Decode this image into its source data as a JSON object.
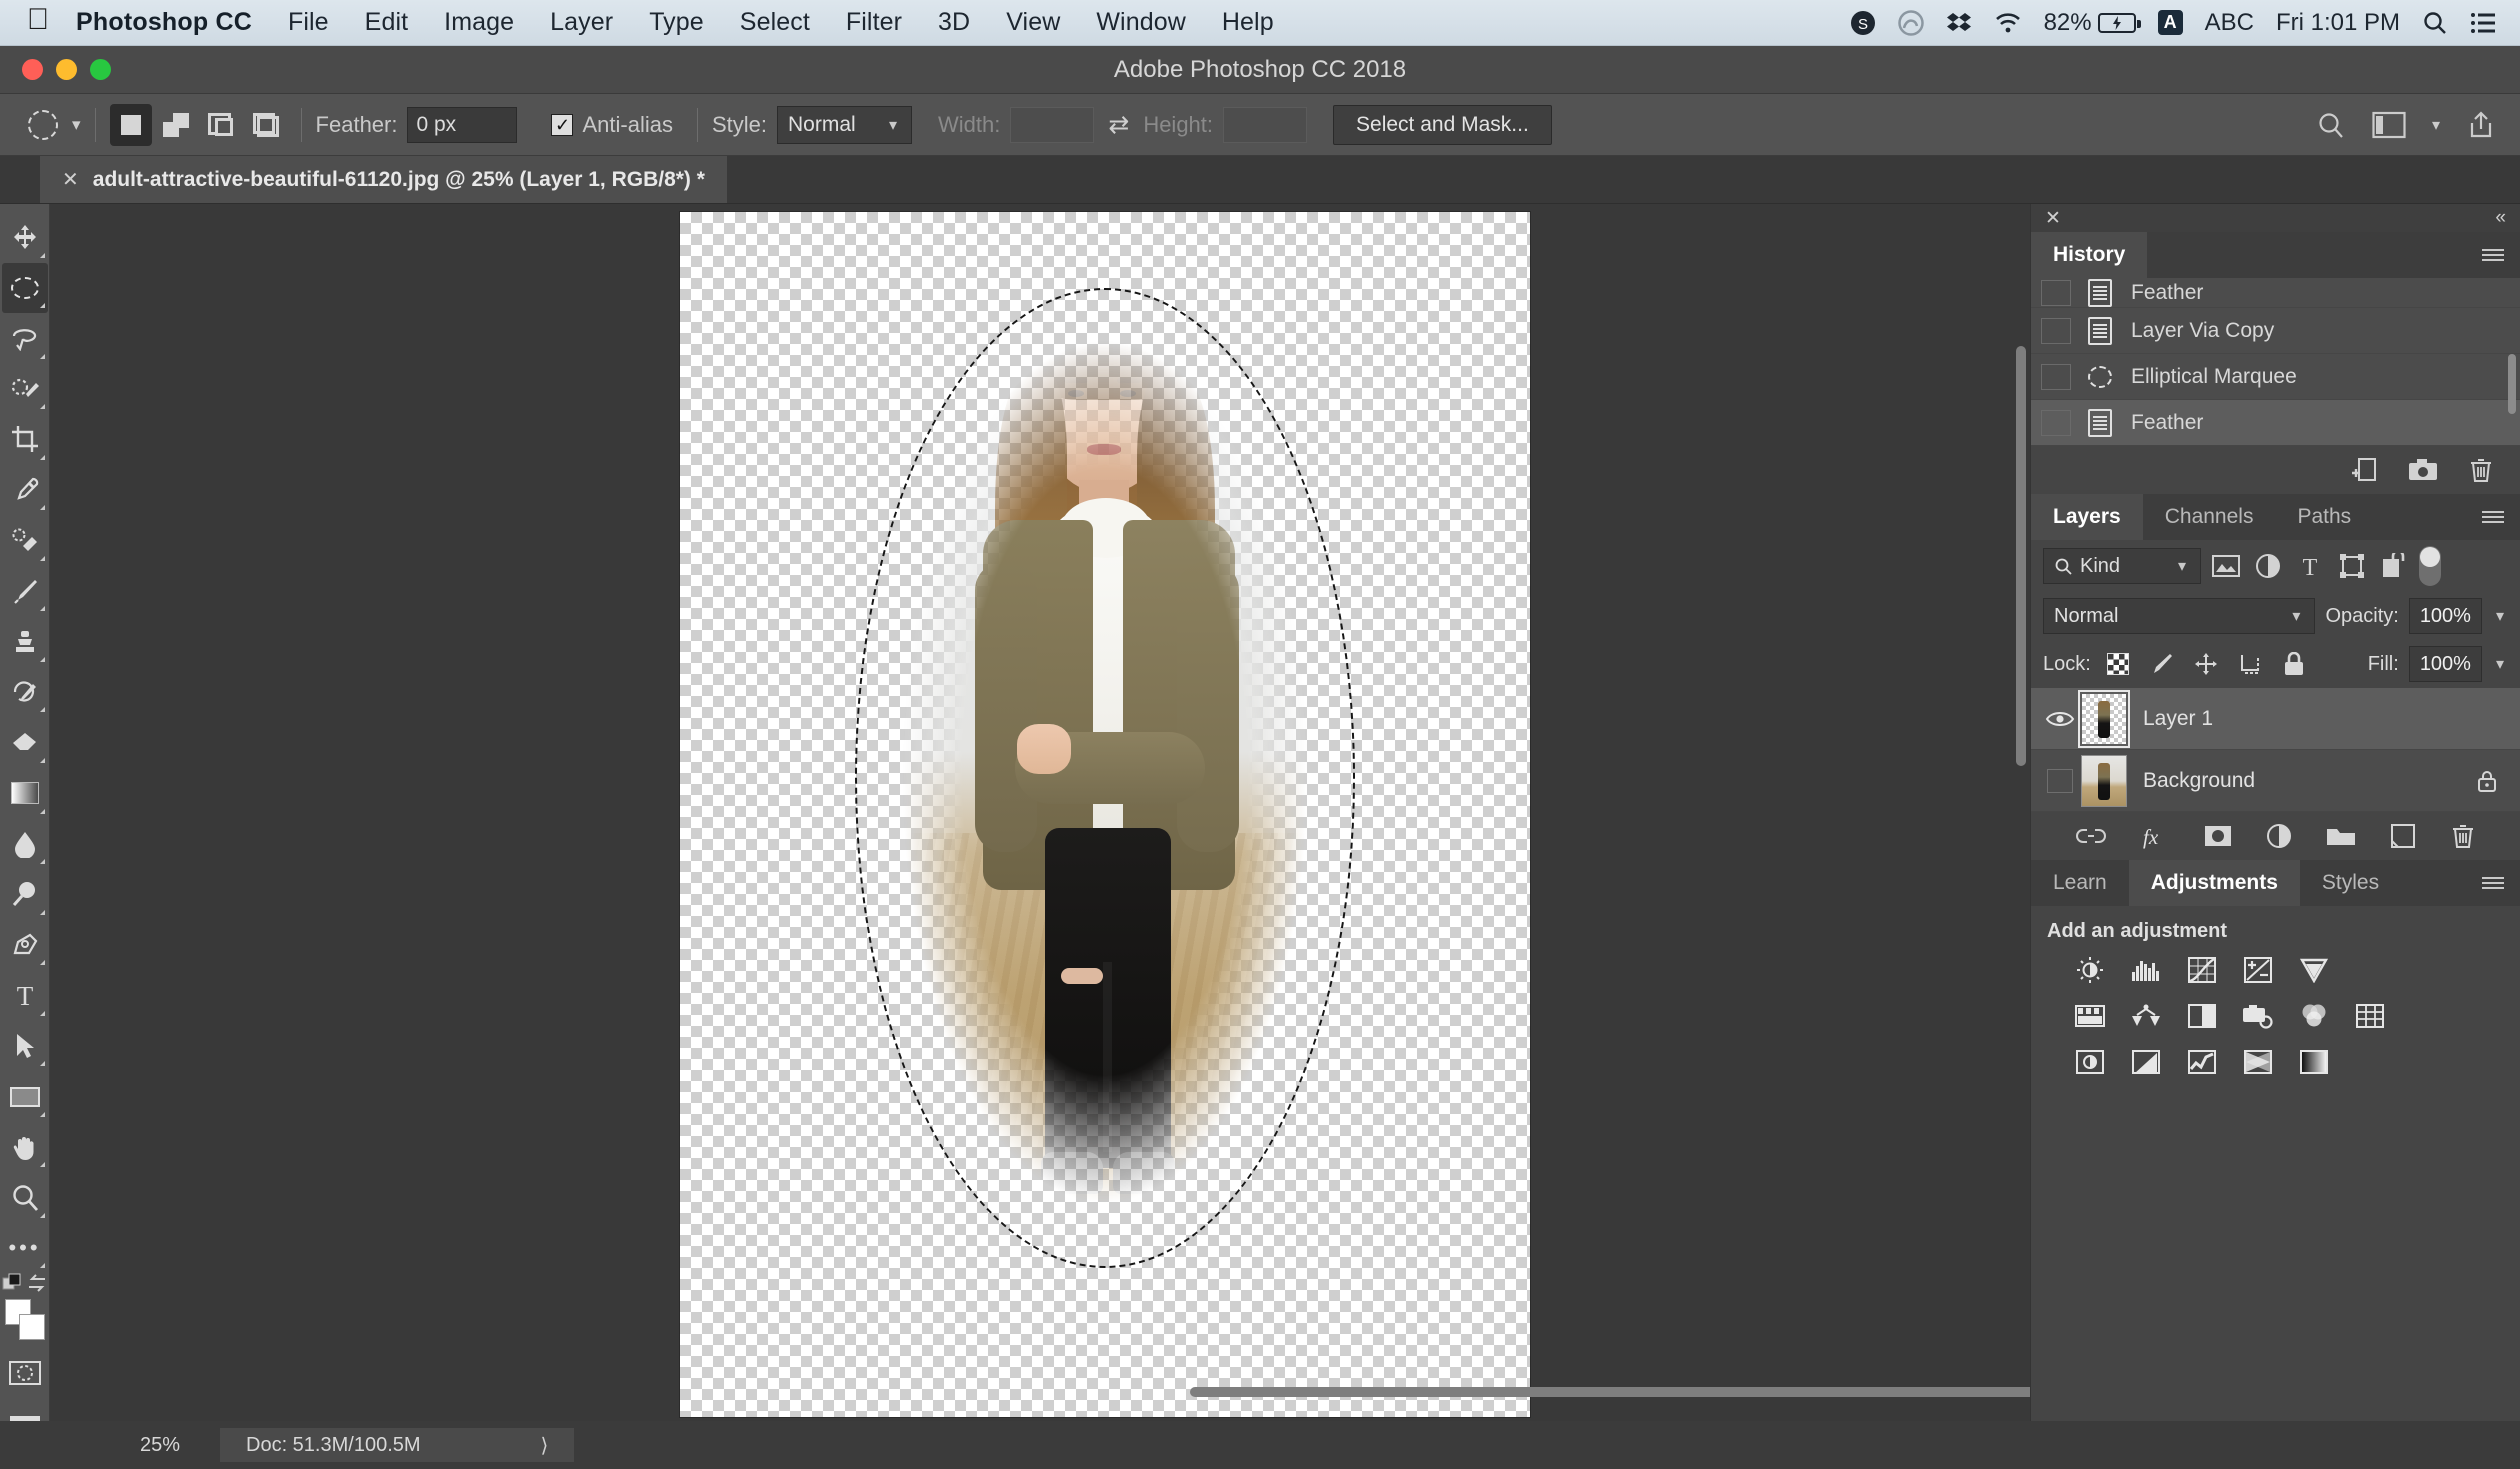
{
  "macbar": {
    "apple_icon": "apple-logo",
    "app_name": "Photoshop CC",
    "menus": [
      "File",
      "Edit",
      "Image",
      "Layer",
      "Type",
      "Select",
      "Filter",
      "3D",
      "View",
      "Window",
      "Help"
    ],
    "status_icons": [
      "skype-icon",
      "creative-cloud-icon",
      "dropbox-icon",
      "wifi-icon"
    ],
    "battery_percent": "82%",
    "battery_state": "charging",
    "input_source_badge": "A",
    "input_source_label": "ABC",
    "clock": "Fri 1:01 PM",
    "search_icon": "search-icon",
    "notification_icon": "list-icon"
  },
  "window": {
    "title": "Adobe Photoshop CC 2018",
    "traffic_lights": [
      "close",
      "minimize",
      "zoom"
    ]
  },
  "options_bar": {
    "tool_icon": "elliptical-marquee-icon",
    "tool_preset_chevron": "chevron-down-icon",
    "selection_modes": [
      {
        "name": "new-selection",
        "active": true
      },
      {
        "name": "add-to-selection",
        "active": false
      },
      {
        "name": "subtract-from-selection",
        "active": false
      },
      {
        "name": "intersect-with-selection",
        "active": false
      }
    ],
    "feather_label": "Feather:",
    "feather_value": "0 px",
    "antialias_label": "Anti-alias",
    "antialias_checked": true,
    "style_label": "Style:",
    "style_value": "Normal",
    "width_label": "Width:",
    "width_value": "",
    "swap_icon": "swap-arrows-icon",
    "height_label": "Height:",
    "height_value": "",
    "select_and_mask_label": "Select and Mask...",
    "right_icons": [
      "search-icon",
      "workspace-icon",
      "chevron-down-icon",
      "share-icon"
    ]
  },
  "document_tab": {
    "close_icon": "close-icon",
    "title": "adult-attractive-beautiful-61120.jpg @ 25% (Layer 1, RGB/8*) *"
  },
  "toolbar": {
    "items": [
      {
        "name": "move-tool",
        "icon": "move-icon",
        "active": false
      },
      {
        "name": "elliptical-marquee-tool",
        "icon": "elliptical-marquee-icon",
        "active": true
      },
      {
        "name": "lasso-tool",
        "icon": "lasso-icon",
        "active": false
      },
      {
        "name": "quick-selection-tool",
        "icon": "quick-selection-icon",
        "active": false
      },
      {
        "name": "crop-tool",
        "icon": "crop-icon",
        "active": false
      },
      {
        "name": "eyedropper-tool",
        "icon": "eyedropper-icon",
        "active": false
      },
      {
        "name": "spot-healing-brush-tool",
        "icon": "healing-brush-icon",
        "active": false
      },
      {
        "name": "brush-tool",
        "icon": "brush-icon",
        "active": false
      },
      {
        "name": "clone-stamp-tool",
        "icon": "clone-stamp-icon",
        "active": false
      },
      {
        "name": "history-brush-tool",
        "icon": "history-brush-icon",
        "active": false
      },
      {
        "name": "eraser-tool",
        "icon": "eraser-icon",
        "active": false
      },
      {
        "name": "gradient-tool",
        "icon": "gradient-icon",
        "active": false
      },
      {
        "name": "blur-tool",
        "icon": "blur-drop-icon",
        "active": false
      },
      {
        "name": "dodge-tool",
        "icon": "dodge-icon",
        "active": false
      },
      {
        "name": "pen-tool",
        "icon": "pen-icon",
        "active": false
      },
      {
        "name": "type-tool",
        "icon": "type-icon",
        "active": false
      },
      {
        "name": "path-selection-tool",
        "icon": "path-arrow-icon",
        "active": false
      },
      {
        "name": "rectangle-tool",
        "icon": "rectangle-icon",
        "active": false
      },
      {
        "name": "hand-tool",
        "icon": "hand-icon",
        "active": false
      },
      {
        "name": "zoom-tool",
        "icon": "magnifier-icon",
        "active": false
      },
      {
        "name": "edit-toolbar",
        "icon": "ellipsis-icon",
        "active": false
      }
    ],
    "default_colors_icon": "default-colors-icon",
    "swap_colors_icon": "swap-colors-icon",
    "foreground_color": "#ffffff",
    "background_color": "#ffffff",
    "quick_mask_icon": "quick-mask-icon"
  },
  "canvas": {
    "zoom": "25%",
    "selection": "elliptical-marquee",
    "layer_content": "woman-portrait-cutout",
    "transparency": "checkerboard"
  },
  "history_panel": {
    "close_icon": "close-icon",
    "collapse_icon": "collapse-panel-icon",
    "tab": "History",
    "menu_icon": "panel-menu-icon",
    "states": [
      {
        "label": "Feather",
        "icon": "document-state-icon",
        "selected": false,
        "clipped": true
      },
      {
        "label": "Layer Via Copy",
        "icon": "document-state-icon",
        "selected": false,
        "clipped": false
      },
      {
        "label": "Elliptical Marquee",
        "icon": "elliptical-marquee-icon",
        "selected": false,
        "clipped": false
      },
      {
        "label": "Feather",
        "icon": "document-state-icon",
        "selected": true,
        "clipped": false
      }
    ],
    "footer_icons": [
      "new-document-from-state-icon",
      "new-snapshot-icon",
      "delete-icon"
    ]
  },
  "layers_panel": {
    "tabs": [
      {
        "label": "Layers",
        "active": true
      },
      {
        "label": "Channels",
        "active": false
      },
      {
        "label": "Paths",
        "active": false
      }
    ],
    "menu_icon": "panel-menu-icon",
    "filter_kind_label": "Kind",
    "filter_search_icon": "search-icon",
    "filter_icons": [
      "pixel-layers-icon",
      "adjustment-layers-icon",
      "type-layers-icon",
      "shape-layers-icon",
      "smart-object-icon"
    ],
    "filter_toggle": "filter-enable-toggle",
    "blend_mode": "Normal",
    "opacity_label": "Opacity:",
    "opacity_value": "100%",
    "lock_label": "Lock:",
    "lock_icons": [
      "lock-transparent-pixels-icon",
      "lock-image-pixels-icon",
      "lock-position-icon",
      "lock-artboard-icon",
      "lock-all-icon"
    ],
    "fill_label": "Fill:",
    "fill_value": "100%",
    "layers": [
      {
        "name": "Layer 1",
        "visible": true,
        "selected": true,
        "locked": false,
        "thumb": "transparent-cutout"
      },
      {
        "name": "Background",
        "visible": false,
        "selected": false,
        "locked": true,
        "thumb": "photo"
      }
    ],
    "footer_icons": [
      "link-layers-icon",
      "layer-style-fx-icon",
      "layer-mask-icon",
      "new-adjustment-layer-icon",
      "new-group-icon",
      "new-layer-icon",
      "delete-layer-icon"
    ]
  },
  "adjustments_panel": {
    "tabs": [
      {
        "label": "Learn",
        "active": false
      },
      {
        "label": "Adjustments",
        "active": true
      },
      {
        "label": "Styles",
        "active": false
      }
    ],
    "menu_icon": "panel-menu-icon",
    "heading": "Add an adjustment",
    "rows": [
      [
        "brightness-contrast-icon",
        "levels-icon",
        "curves-icon",
        "exposure-icon",
        "vibrance-icon"
      ],
      [
        "hue-saturation-icon",
        "color-balance-icon",
        "black-and-white-icon",
        "photo-filter-icon",
        "channel-mixer-icon",
        "color-lookup-icon"
      ],
      [
        "invert-icon",
        "posterize-icon",
        "threshold-icon",
        "gradient-map-icon",
        "selective-color-icon"
      ]
    ]
  },
  "status_bar": {
    "zoom": "25%",
    "doc_info": "Doc: 51.3M/100.5M",
    "expand_icon": "chevron-right-icon"
  },
  "bottom_stub": {
    "close_icon": "close-icon"
  }
}
